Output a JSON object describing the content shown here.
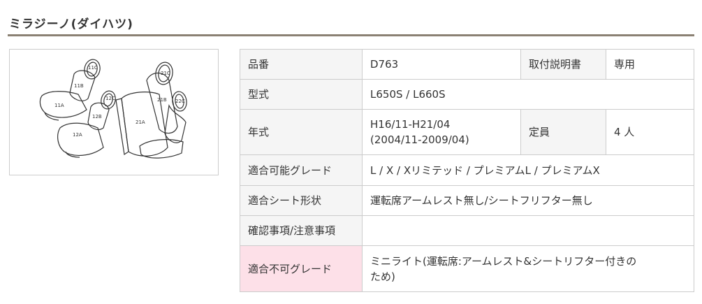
{
  "page": {
    "title": "ミラジーノ(ダイハツ)"
  },
  "diagram": {
    "part_labels": [
      "11C",
      "11B",
      "11A",
      "12C",
      "12B",
      "12A",
      "21C",
      "21B",
      "22C",
      "21A"
    ]
  },
  "spec": {
    "part_no_label": "品番",
    "part_no": "D763",
    "manual_label": "取付説明書",
    "manual": "専用",
    "model_label": "型式",
    "model": "L650S / L660S",
    "year_label": "年式",
    "year_line1": "H16/11-H21/04",
    "year_line2": "(2004/11-2009/04)",
    "capacity_label": "定員",
    "capacity": "4 人",
    "grades_label": "適合可能グレード",
    "grades": "L / X / Xリミテッド / プレミアムL / プレミアムX",
    "seat_shape_label": "適合シート形状",
    "seat_shape": "運転席アームレスト無し/シートフリフター無し",
    "notes_label": "確認事項/注意事項",
    "notes": "",
    "incompatible_label": "適合不可グレード",
    "incompatible_line1": "ミニライト(運転席:アームレスト&シートリフター付きの",
    "incompatible_line2": "ため)"
  },
  "colors": {
    "rule": "#8b8173",
    "header_cell": "#f5f5f5",
    "warning_cell": "#fde0e8",
    "border": "#cccccc"
  }
}
